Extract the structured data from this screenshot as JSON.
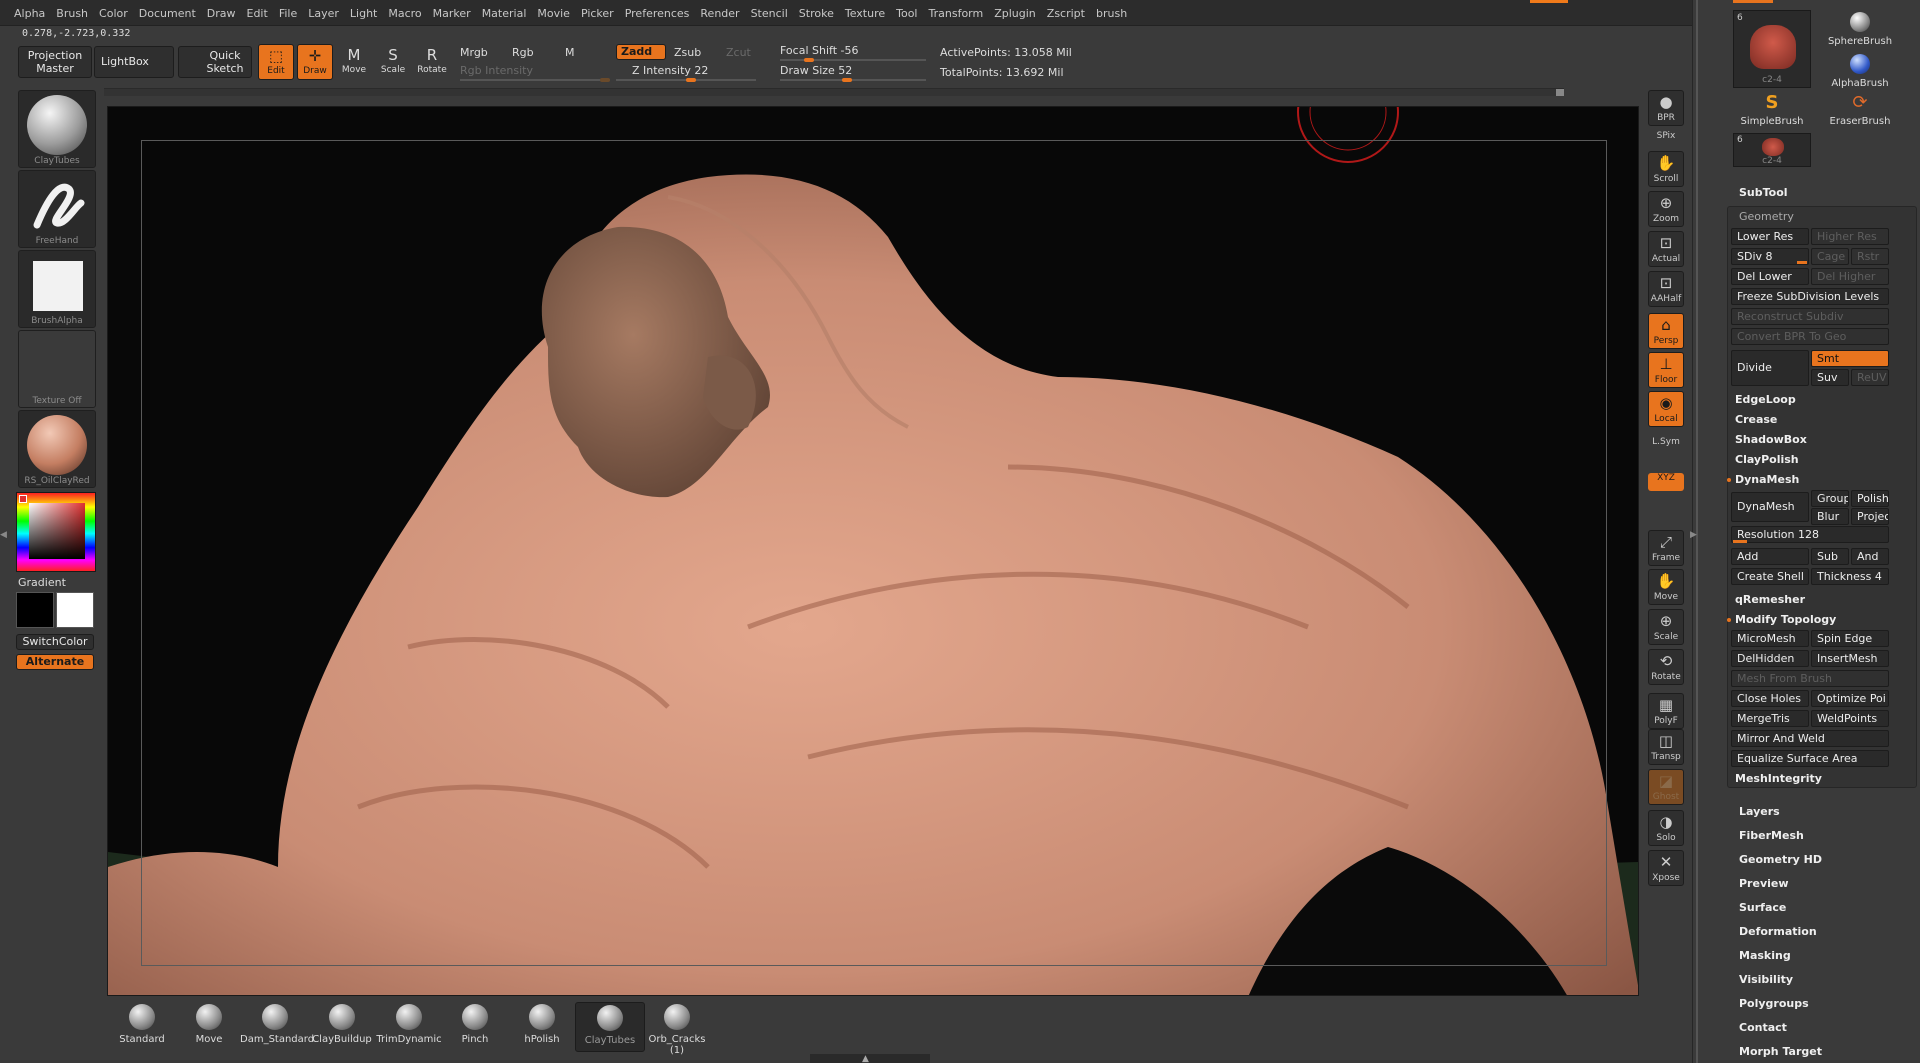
{
  "menu": [
    "Alpha",
    "Brush",
    "Color",
    "Document",
    "Draw",
    "Edit",
    "File",
    "Layer",
    "Light",
    "Macro",
    "Marker",
    "Material",
    "Movie",
    "Picker",
    "Preferences",
    "Render",
    "Stencil",
    "Stroke",
    "Texture",
    "Tool",
    "Transform",
    "Zplugin",
    "Zscript",
    "brush"
  ],
  "coords": "0.278,-2.723,0.332",
  "shelf": {
    "projection_master": "Projection Master",
    "lightbox": "LightBox",
    "quick_sketch": "Quick Sketch",
    "edit": "Edit",
    "draw": "Draw",
    "move": "Move",
    "scale": "Scale",
    "rotate": "Rotate",
    "mrgb": "Mrgb",
    "rgb": "Rgb",
    "m": "M",
    "rgb_intensity": "Rgb Intensity",
    "zadd": "Zadd",
    "zsub": "Zsub",
    "zcut": "Zcut",
    "z_intensity": "Z Intensity 22",
    "focal_shift": "Focal Shift -56",
    "draw_size": "Draw Size 52",
    "active_points": "ActivePoints: 13.058 Mil",
    "total_points": "TotalPoints: 13.692 Mil"
  },
  "left": {
    "brush": "ClayTubes",
    "stroke": "FreeHand",
    "alpha": "BrushAlpha",
    "texture": "Texture Off",
    "material": "RS_OilClayRed",
    "gradient": "Gradient",
    "switch_color": "SwitchColor",
    "alternate": "Alternate"
  },
  "right_tools": [
    "BPR",
    "SPix",
    "Scroll",
    "Zoom",
    "Actual",
    "AAHalf",
    "Persp",
    "Floor",
    "Local",
    "L.Sym",
    "XYZ",
    "Frame",
    "Move",
    "Scale",
    "Rotate",
    "PolyF",
    "Transp",
    "Ghost",
    "Solo",
    "Xpose"
  ],
  "tool_palette": {
    "count_a": "6",
    "tool_name_a": "c2-4",
    "sphere_brush": "SphereBrush",
    "alpha_brush": "AlphaBrush",
    "simple_brush": "SimpleBrush",
    "eraser_brush": "EraserBrush",
    "count_b": "6",
    "tool_name_b": "c2-4"
  },
  "subtool": "SubTool",
  "geometry": {
    "title": "Geometry",
    "lower_res": "Lower Res",
    "higher_res": "Higher Res",
    "sdiv": "SDiv 8",
    "cage": "Cage",
    "rstr": "Rstr",
    "del_lower": "Del Lower",
    "del_higher": "Del Higher",
    "freeze": "Freeze SubDivision Levels",
    "reconstruct": "Reconstruct Subdiv",
    "convert_bpr": "Convert BPR To Geo",
    "divide": "Divide",
    "smt": "Smt",
    "suv": "Suv",
    "reuv": "ReUV",
    "edgeloop": "EdgeLoop",
    "crease": "Crease",
    "shadowbox": "ShadowBox",
    "claypolish": "ClayPolish",
    "dynamesh_head": "DynaMesh",
    "dynamesh": "DynaMesh",
    "group": "Group",
    "polish": "Polish",
    "blur": "Blur",
    "project": "Projec",
    "resolution": "Resolution 128",
    "add": "Add",
    "sub": "Sub",
    "and": "And",
    "create_shell": "Create Shell",
    "thickness": "Thickness 4",
    "qremesher": "qRemesher",
    "modify_topology": "Modify Topology",
    "micromesh": "MicroMesh",
    "spin_edge": "Spin Edge",
    "delhidden": "DelHidden",
    "insertmesh": "InsertMesh",
    "mesh_from_brush": "Mesh From Brush",
    "close_holes": "Close Holes",
    "optimize": "Optimize Poi",
    "mergetris": "MergeTris",
    "weldpoints": "WeldPoints",
    "mirror_weld": "Mirror And Weld",
    "equalize": "Equalize Surface Area",
    "meshintegrity": "MeshIntegrity"
  },
  "panels": [
    "Layers",
    "FiberMesh",
    "Geometry HD",
    "Preview",
    "Surface",
    "Deformation",
    "Masking",
    "Visibility",
    "Polygroups",
    "Contact",
    "Morph Target"
  ],
  "brushes": [
    {
      "label": "Standard"
    },
    {
      "label": "Move"
    },
    {
      "label": "Dam_Standard"
    },
    {
      "label": "ClayBuildup"
    },
    {
      "label": "TrimDynamic"
    },
    {
      "label": "Pinch"
    },
    {
      "label": "hPolish"
    },
    {
      "label": "ClayTubes"
    },
    {
      "label": "Orb_Cracks (1)"
    }
  ],
  "colors": {
    "accent": "#e8741e",
    "skin": "#d9957a"
  }
}
